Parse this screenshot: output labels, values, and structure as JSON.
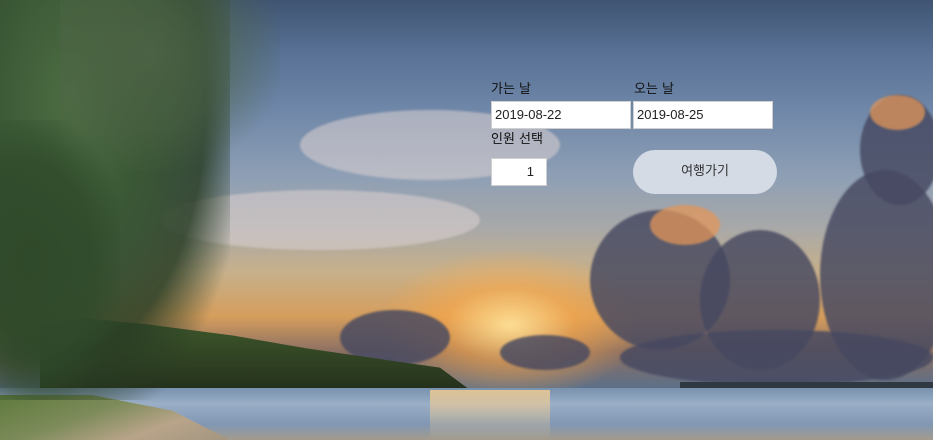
{
  "form": {
    "departure_label": "가는 날",
    "departure_value": "2019-08-22",
    "return_label": "오는 날",
    "return_value": "2019-08-25",
    "people_label": "인원 선택",
    "people_value": "1",
    "submit_label": "여행가기"
  }
}
